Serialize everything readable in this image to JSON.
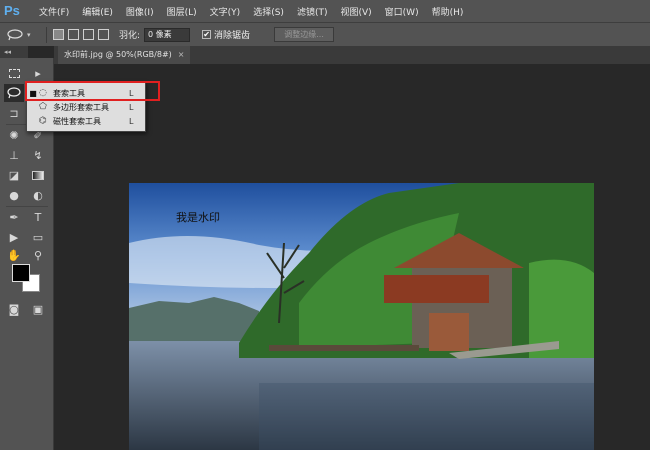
{
  "app": {
    "logo": "Ps"
  },
  "menu": [
    "文件(F)",
    "编辑(E)",
    "图像(I)",
    "图层(L)",
    "文字(Y)",
    "选择(S)",
    "滤镜(T)",
    "视图(V)",
    "窗口(W)",
    "帮助(H)"
  ],
  "options_bar": {
    "feather_label": "羽化:",
    "feather_value": "0 像素",
    "antialias_label": "消除锯齿",
    "antialias_checked": true,
    "refine_edge_label": "调整边缘..."
  },
  "toolbar": {
    "collapse_glyph": "◂◂"
  },
  "document": {
    "tab_title": "水印前.jpg @ 50%(RGB/8#)",
    "close_glyph": "×"
  },
  "image": {
    "watermark_text": "我是水印"
  },
  "flyout": {
    "items": [
      {
        "label": "套索工具",
        "shortcut": "L",
        "selected": true,
        "icon": "lasso-icon"
      },
      {
        "label": "多边形套索工具",
        "shortcut": "L",
        "selected": false,
        "icon": "polygonal-lasso-icon"
      },
      {
        "label": "磁性套索工具",
        "shortcut": "L",
        "selected": false,
        "icon": "magnetic-lasso-icon"
      }
    ],
    "highlight_color": "#e02020"
  },
  "colors": {
    "foreground": "#000000",
    "background": "#ffffff"
  }
}
